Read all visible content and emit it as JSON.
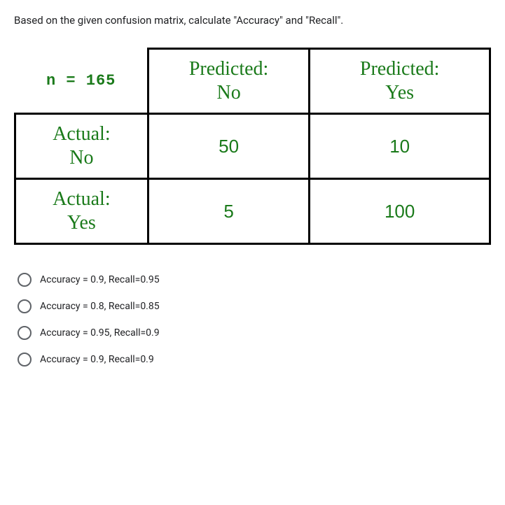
{
  "question": "Based on the given confusion matrix, calculate \"Accuracy\" and \"Recall\".",
  "matrix": {
    "n_label": "n = 165",
    "col_headers": {
      "c1_line1": "Predicted:",
      "c1_line2": "No",
      "c2_line1": "Predicted:",
      "c2_line2": "Yes"
    },
    "rows": {
      "r1_line1": "Actual:",
      "r1_line2": "No",
      "r1_v1": "50",
      "r1_v2": "10",
      "r2_line1": "Actual:",
      "r2_line2": "Yes",
      "r2_v1": "5",
      "r2_v2": "100"
    }
  },
  "options": [
    "Accuracy = 0.9, Recall=0.95",
    "Accuracy = 0.8, Recall=0.85",
    "Accuracy = 0.95, Recall=0.9",
    "Accuracy = 0.9, Recall=0.9"
  ],
  "chart_data": {
    "type": "table",
    "title": "Confusion Matrix",
    "n": 165,
    "columns": [
      "Predicted: No",
      "Predicted: Yes"
    ],
    "rows": [
      "Actual: No",
      "Actual: Yes"
    ],
    "values": [
      [
        50,
        10
      ],
      [
        5,
        100
      ]
    ]
  }
}
